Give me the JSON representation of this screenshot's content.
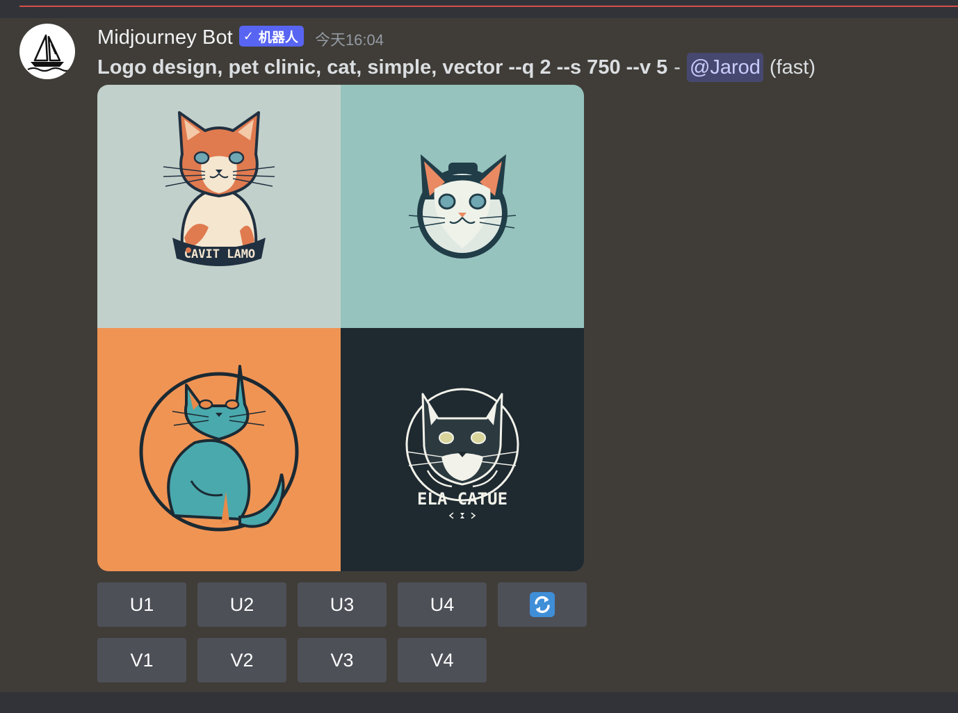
{
  "message": {
    "username": "Midjourney Bot",
    "bot_tag": {
      "check": "✓",
      "label": "机器人"
    },
    "timestamp": "今天16:04",
    "prompt": "Logo design, pet clinic, cat, simple, vector --q 2 --s 750 --v 5",
    "separator": "-",
    "mention": "@Jarod",
    "speed": "(fast)"
  },
  "image_grid": {
    "tiles": [
      {
        "background": "#c2d0cb",
        "badge_text": "CAVIT LAMO"
      },
      {
        "background": "#96c3bd",
        "badge_text": ""
      },
      {
        "background": "#f09454",
        "badge_text": ""
      },
      {
        "background": "#1e2930",
        "badge_text": "ELA CATUE"
      }
    ]
  },
  "buttons": {
    "upscale": [
      "U1",
      "U2",
      "U3",
      "U4"
    ],
    "variation": [
      "V1",
      "V2",
      "V3",
      "V4"
    ],
    "reroll_icon": "refresh-icon"
  },
  "colors": {
    "message_bg": "#403d38",
    "bot_tag": "#5865f2",
    "mention_bg": "rgba(88,101,242,0.3)",
    "button_bg": "#4e5058",
    "reroll_icon": "#3f8ed8",
    "divider": "#d9504a"
  }
}
